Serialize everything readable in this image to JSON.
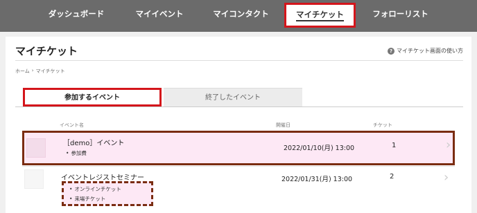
{
  "nav": {
    "items": [
      {
        "label": "ダッシュボード"
      },
      {
        "label": "マイイベント"
      },
      {
        "label": "マイコンタクト"
      },
      {
        "label": "マイチケット"
      },
      {
        "label": "フォローリスト"
      }
    ]
  },
  "page": {
    "title": "マイチケット",
    "help_link": "マイチケット画面の使い方",
    "help_icon": "question-icon",
    "breadcrumb": {
      "home": "ホーム",
      "separator": "›",
      "current": "マイチケット"
    }
  },
  "tabs": {
    "active": "参加するイベント",
    "inactive": "終了したイベント"
  },
  "table": {
    "headers": {
      "name": "イベント名",
      "date": "開催日",
      "ticket": "チケット"
    },
    "rows": [
      {
        "name": "［demo］イベント",
        "tickets": [
          "参加費"
        ],
        "date": "2022/01/10(月) 13:00",
        "count": "1"
      },
      {
        "name": "イベントレジストセミナー",
        "tickets": [
          "オンラインチケット",
          "来場チケット"
        ],
        "date": "2022/01/31(月) 13:00",
        "count": "2"
      }
    ],
    "chevron": "›"
  },
  "colors": {
    "nav_bg": "#6b6b6b",
    "highlight_red": "#d4151b",
    "highlight_brown": "#7a2c11",
    "row_pink": "#fde8f5"
  }
}
